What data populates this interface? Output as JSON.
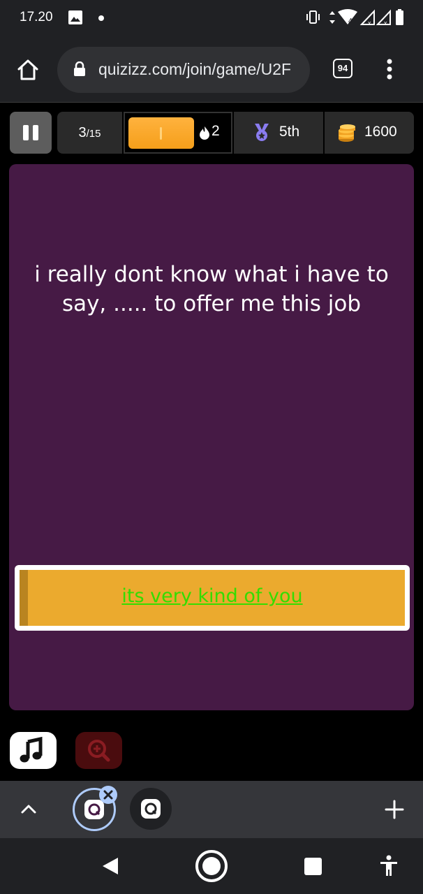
{
  "status_bar": {
    "time": "17.20",
    "icons": [
      "gallery-icon",
      "notification-dot-icon",
      "vibrate-icon",
      "data-arrows-icon",
      "wifi-icon",
      "signal-icon",
      "signal-icon",
      "battery-icon"
    ]
  },
  "browser": {
    "url": "quizizz.com/join/game/U2F",
    "tab_count": "94",
    "icons": {
      "home": "home-icon",
      "lock": "lock-icon",
      "menu": "more-vert-icon"
    }
  },
  "game_header": {
    "question_current": "3",
    "question_total": "/15",
    "progress": 1.0,
    "streak": "2",
    "rank": "5th",
    "coins": "1600",
    "colors": {
      "progress": "#ffb23e",
      "medal": "#8a7cf0",
      "coins": "#f0a020"
    }
  },
  "question": {
    "text": "i really dont know what i have to say, ..... to offer me this job",
    "background": "#461a45"
  },
  "answer": {
    "text": "its very kind of you",
    "background": "#ebaa2e",
    "text_color": "#33dd00"
  },
  "controls": {
    "music_icon": "music-note-icon",
    "zoom_icon": "zoom-in-icon"
  },
  "tab_strip": {
    "icons": [
      "chevron-up-icon",
      "quizizz-tab-icon",
      "close-icon",
      "quizizz-tab-icon",
      "plus-icon"
    ]
  },
  "nav_bar": {
    "icons": [
      "back-icon",
      "home-circle-icon",
      "recents-icon",
      "accessibility-icon"
    ]
  }
}
